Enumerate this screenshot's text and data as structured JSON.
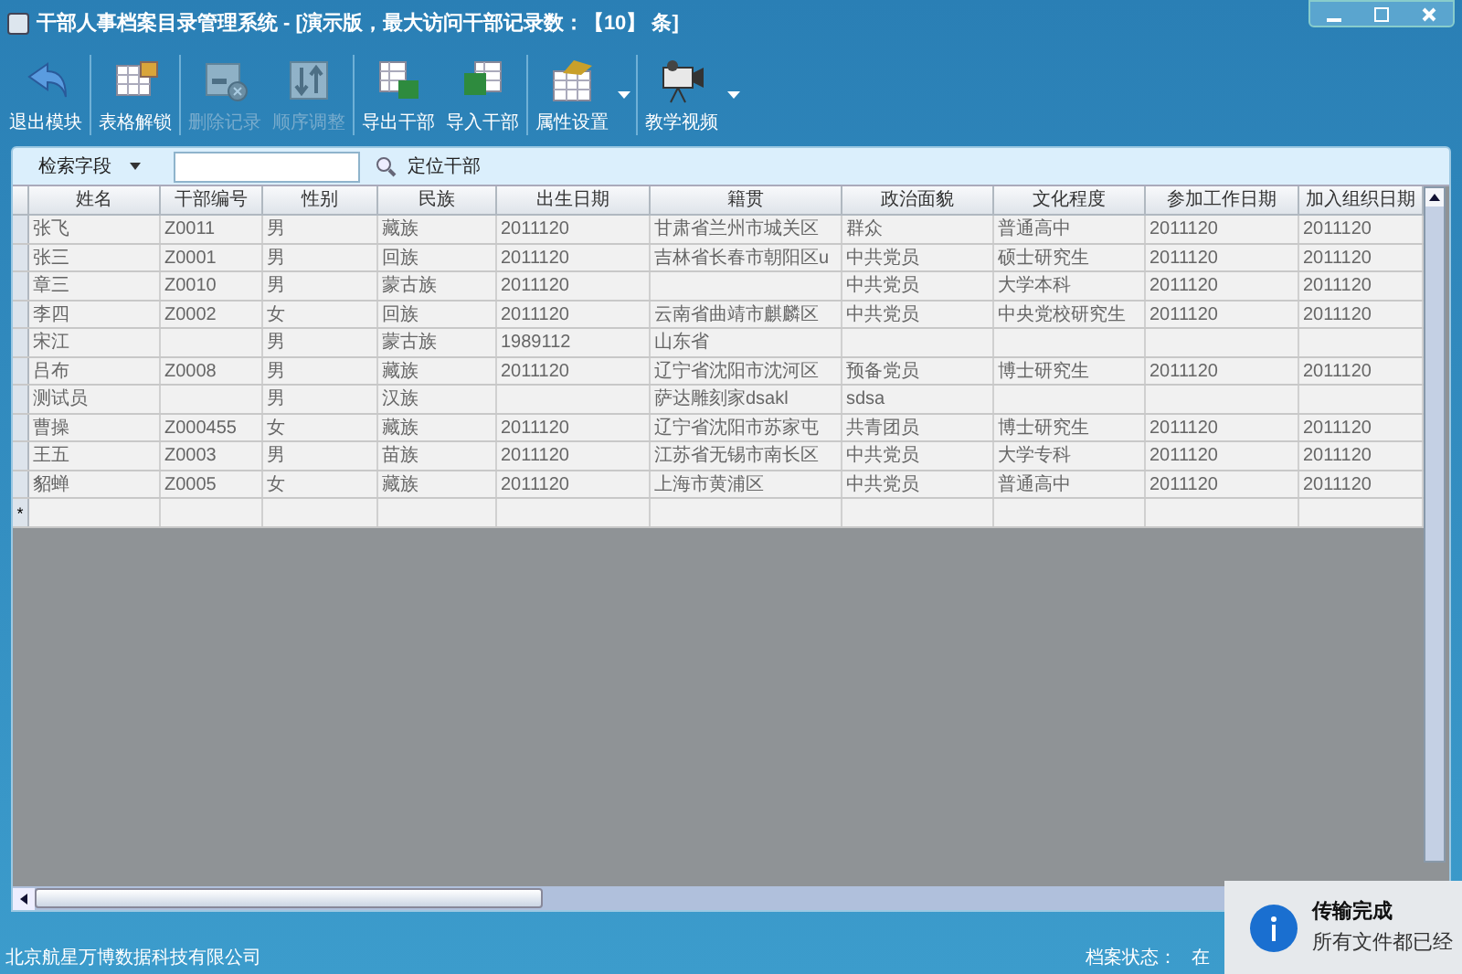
{
  "window": {
    "title": "干部人事档案目录管理系统 - [演示版，最大访问干部记录数：【10】 条]"
  },
  "toolbar": [
    {
      "kind": "back",
      "label": "退出模块",
      "disabled": false,
      "dropdown": false
    },
    {
      "kind": "unlock",
      "label": "表格解锁",
      "disabled": false,
      "dropdown": false
    },
    {
      "kind": "delete",
      "label": "删除记录",
      "disabled": true,
      "dropdown": false
    },
    {
      "kind": "sort",
      "label": "顺序调整",
      "disabled": true,
      "dropdown": false
    },
    {
      "kind": "export",
      "label": "导出干部",
      "disabled": false,
      "dropdown": false
    },
    {
      "kind": "import",
      "label": "导入干部",
      "disabled": false,
      "dropdown": false
    },
    {
      "kind": "props",
      "label": "属性设置",
      "disabled": false,
      "dropdown": true
    },
    {
      "kind": "video",
      "label": "教学视频",
      "disabled": false,
      "dropdown": true
    }
  ],
  "search": {
    "field_label": "检索字段",
    "locate_label": "定位干部"
  },
  "table": {
    "columns": [
      "姓名",
      "干部编号",
      "性别",
      "民族",
      "出生日期",
      "籍贯",
      "政治面貌",
      "文化程度",
      "参加工作日期",
      "加入组织日期"
    ],
    "rows": [
      [
        "张飞",
        "Z0011",
        "男",
        "藏族",
        "2011120",
        "甘肃省兰州市城关区",
        "群众",
        "普通高中",
        "2011120",
        "2011120"
      ],
      [
        "张三",
        "Z0001",
        "男",
        "回族",
        "2011120",
        "吉林省长春市朝阳区u",
        "中共党员",
        "硕士研究生",
        "2011120",
        "2011120"
      ],
      [
        "章三",
        "Z0010",
        "男",
        "蒙古族",
        "2011120",
        "",
        "中共党员",
        "大学本科",
        "2011120",
        "2011120"
      ],
      [
        "李四",
        "Z0002",
        "女",
        "回族",
        "2011120",
        "云南省曲靖市麒麟区",
        "中共党员",
        "中央党校研究生",
        "2011120",
        "2011120"
      ],
      [
        "宋江",
        "",
        "男",
        "蒙古族",
        "1989112",
        "山东省",
        "",
        "",
        "",
        ""
      ],
      [
        "吕布",
        "Z0008",
        "男",
        "藏族",
        "2011120",
        "辽宁省沈阳市沈河区",
        "预备党员",
        "博士研究生",
        "2011120",
        "2011120"
      ],
      [
        "测试员",
        "",
        "男",
        "汉族",
        "",
        "萨达雕刻家dsakl",
        "sdsa",
        "",
        "",
        ""
      ],
      [
        "曹操",
        "Z000455",
        "女",
        "藏族",
        "2011120",
        "辽宁省沈阳市苏家屯",
        "共青团员",
        "博士研究生",
        "2011120",
        "2011120"
      ],
      [
        "王五",
        "Z0003",
        "男",
        "苗族",
        "2011120",
        "江苏省无锡市南长区",
        "中共党员",
        "大学专科",
        "2011120",
        "2011120"
      ],
      [
        "貂蝉",
        "Z0005",
        "女",
        "藏族",
        "2011120",
        "上海市黄浦区",
        "中共党员",
        "普通高中",
        "2011120",
        "2011120"
      ]
    ],
    "new_row_marker": "*"
  },
  "status_bar": {
    "company": "北京航星万博数据科技有限公司",
    "state_label": "档案状态：",
    "state_value": "在"
  },
  "notification": {
    "title": "传输完成",
    "message": "所有文件都已经"
  }
}
